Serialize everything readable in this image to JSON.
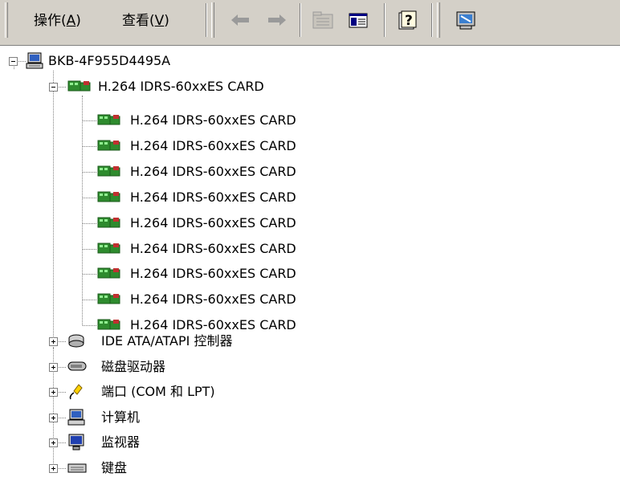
{
  "toolbar": {
    "menu_action": "操作(A)",
    "menu_action_text": "操作(",
    "menu_action_key": "A",
    "menu_view_text": "查看(",
    "menu_view_key": "V",
    "buttons": [
      "back-icon",
      "forward-icon",
      "up-folder-icon",
      "show-hide-tree-icon",
      "help-icon",
      "scan-hardware-icon"
    ]
  },
  "tree": {
    "computer": "BKB-4F955D4495A",
    "category_card": "H.264 IDRS-60xxES CARD",
    "cards": [
      "H.264 IDRS-60xxES CARD",
      "H.264 IDRS-60xxES CARD",
      "H.264 IDRS-60xxES CARD",
      "H.264 IDRS-60xxES CARD",
      "H.264 IDRS-60xxES CARD",
      "H.264 IDRS-60xxES CARD",
      "H.264 IDRS-60xxES CARD",
      "H.264 IDRS-60xxES CARD",
      "H.264 IDRS-60xxES CARD"
    ],
    "categories": [
      {
        "label": "IDE ATA/ATAPI 控制器",
        "icon": "ide-controller-icon"
      },
      {
        "label": "磁盘驱动器",
        "icon": "disk-drive-icon"
      },
      {
        "label": "端口 (COM 和 LPT)",
        "icon": "port-icon"
      },
      {
        "label": "计算机",
        "icon": "computer-icon"
      },
      {
        "label": "监视器",
        "icon": "monitor-icon"
      },
      {
        "label": "键盘",
        "icon": "keyboard-icon"
      }
    ]
  },
  "colors": {
    "toolbar_bg": "#d4d0c8",
    "card_green": "#2e8b2e",
    "card_red": "#c03030"
  }
}
